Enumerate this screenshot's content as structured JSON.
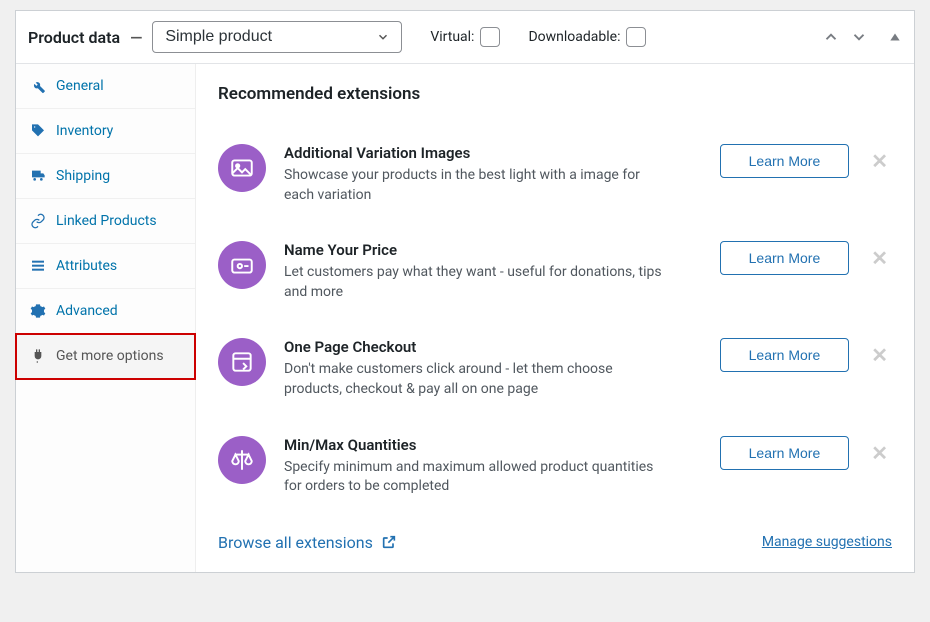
{
  "header": {
    "title": "Product data",
    "select_value": "Simple product",
    "virtual_label": "Virtual:",
    "downloadable_label": "Downloadable:"
  },
  "sidebar": {
    "items": [
      {
        "label": "General",
        "icon": "wrench"
      },
      {
        "label": "Inventory",
        "icon": "tag"
      },
      {
        "label": "Shipping",
        "icon": "truck"
      },
      {
        "label": "Linked Products",
        "icon": "link"
      },
      {
        "label": "Attributes",
        "icon": "list"
      },
      {
        "label": "Advanced",
        "icon": "gear"
      },
      {
        "label": "Get more options",
        "icon": "plug",
        "active": true
      }
    ]
  },
  "content": {
    "section_title": "Recommended extensions",
    "extensions": [
      {
        "title": "Additional Variation Images",
        "desc": "Showcase your products in the best light with a image for each variation",
        "btn": "Learn More",
        "icon": "image"
      },
      {
        "title": "Name Your Price",
        "desc": "Let customers pay what they want - useful for donations, tips and more",
        "btn": "Learn More",
        "icon": "price"
      },
      {
        "title": "One Page Checkout",
        "desc": "Don't make customers click around - let them choose products, checkout & pay all on one page",
        "btn": "Learn More",
        "icon": "page"
      },
      {
        "title": "Min/Max Quantities",
        "desc": "Specify minimum and maximum allowed product quantities for orders to be completed",
        "btn": "Learn More",
        "icon": "scale"
      }
    ],
    "browse_label": "Browse all extensions",
    "manage_label": "Manage suggestions"
  }
}
